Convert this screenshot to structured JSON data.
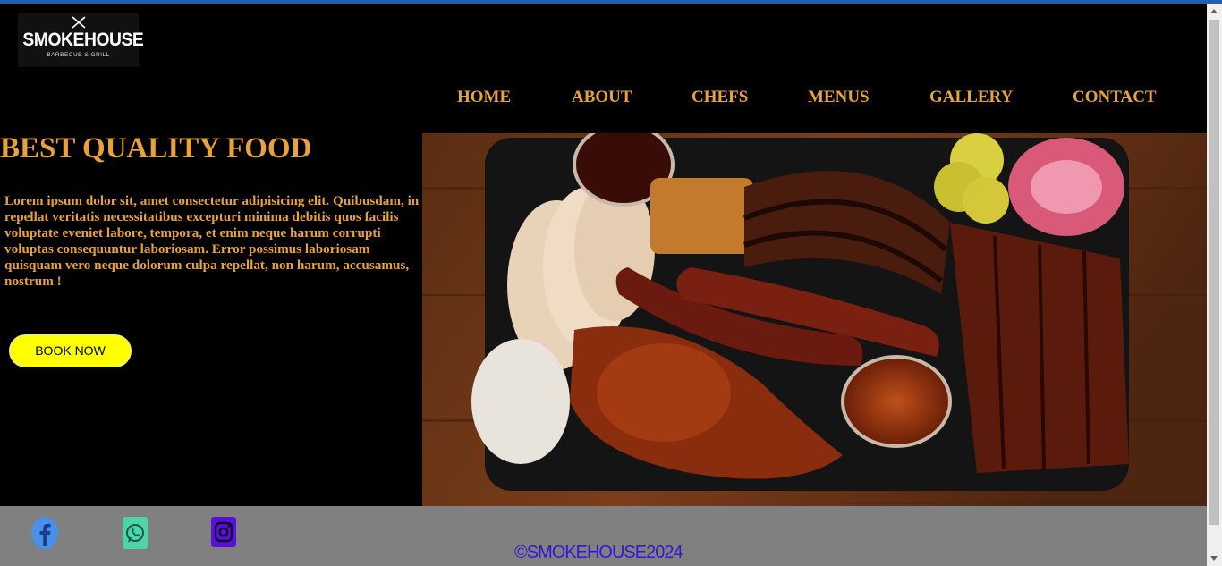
{
  "brand": {
    "name": "SMOKEHOUSE",
    "tagline": "BARBECUE & GRILL"
  },
  "nav": {
    "items": [
      {
        "label": "HOME"
      },
      {
        "label": "ABOUT"
      },
      {
        "label": "CHEFS"
      },
      {
        "label": "MENUS"
      },
      {
        "label": "GALLERY"
      },
      {
        "label": "CONTACT"
      }
    ]
  },
  "hero": {
    "title": "BEST QUALITY FOOD",
    "text": "Lorem ipsum dolor sit, amet consectetur adipisicing elit. Quibusdam, in repellat veritatis necessitatibus excepturi minima debitis quos facilis voluptate eveniet labore, tempora, et enim neque harum corrupti voluptas consequuntur laboriosam. Error possimus laboriosam quisquam vero neque dolorum culpa repellat, non harum, accusamus, nostrum !",
    "button_label": "BOOK NOW"
  },
  "footer": {
    "social_icons": [
      "facebook-icon",
      "whatsapp-icon",
      "instagram-icon"
    ],
    "copyright": "©SMOKEHOUSE2024"
  },
  "colors": {
    "accent": "#e8a23c",
    "button": "#ffff00",
    "footer_bg": "#808080",
    "copyright_text": "#3a14d6"
  }
}
